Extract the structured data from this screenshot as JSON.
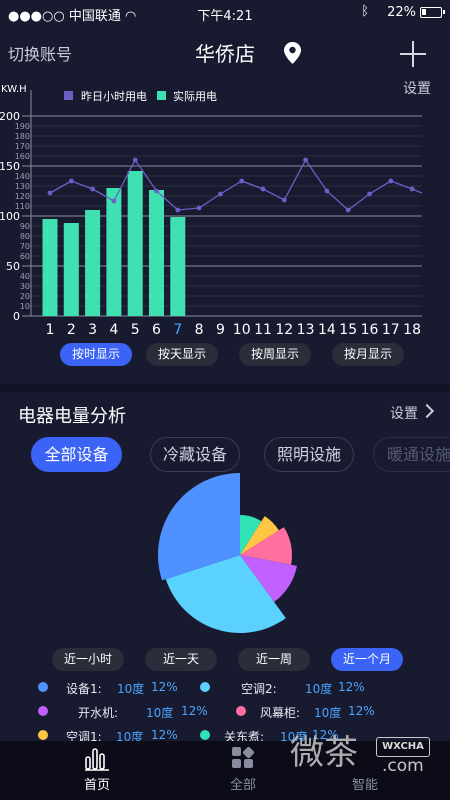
{
  "status": {
    "signal": "●●●○○ 中国联通 ",
    "time": "下午4:21",
    "battery": "22%"
  },
  "header": {
    "switch_account": "切换账号",
    "title": "华侨店",
    "settings": "设置"
  },
  "chart_data": {
    "type": "bar",
    "unit_label": "KW.H",
    "legend": [
      "昨日小时用电",
      "实际用电"
    ],
    "x": [
      "1",
      "2",
      "3",
      "4",
      "5",
      "6",
      "7",
      "8",
      "9",
      "10",
      "11",
      "12",
      "13",
      "14",
      "15",
      "16",
      "17",
      "18"
    ],
    "highlight_x": "7",
    "ylim": [
      0,
      200
    ],
    "y_ticks": [
      0,
      10,
      20,
      30,
      40,
      50,
      60,
      70,
      80,
      90,
      100,
      110,
      120,
      130,
      140,
      150,
      160,
      170,
      180,
      190,
      200
    ],
    "y_major": [
      0,
      50,
      100,
      150,
      200
    ],
    "series": [
      {
        "name": "实际用电",
        "kind": "bar",
        "color": "#3fe1b0",
        "values": [
          97,
          93,
          106,
          128,
          145,
          126,
          99
        ]
      },
      {
        "name": "昨日小时用电",
        "kind": "line",
        "color": "#6b5fc7",
        "values": [
          123,
          135,
          127,
          115,
          156,
          125,
          106,
          108,
          122,
          135,
          127,
          116,
          156,
          125,
          106,
          122,
          135,
          127
        ]
      }
    ]
  },
  "chart_toggles": [
    "按时显示",
    "按天显示",
    "按周显示",
    "按月显示"
  ],
  "analysis": {
    "title": "电器电量分析",
    "settings": "设置"
  },
  "categories": [
    "全部设备",
    "冷藏设备",
    "照明设施",
    "暖通设施"
  ],
  "pie_data": {
    "type": "pie",
    "slices": [
      {
        "name": "设备1",
        "color": "#4f92ff",
        "fraction": 0.3
      },
      {
        "name": "空调2",
        "color": "#5bd1ff",
        "fraction": 0.3
      },
      {
        "name": "开水机",
        "color": "#c061ff",
        "fraction": 0.12
      },
      {
        "name": "风幕柜",
        "color": "#ff6fa0",
        "fraction": 0.12
      },
      {
        "name": "空调1",
        "color": "#ffc646",
        "fraction": 0.07
      },
      {
        "name": "关东煮",
        "color": "#2fe3b4",
        "fraction": 0.09
      }
    ]
  },
  "periods": [
    "近一小时",
    "近一天",
    "近一周",
    "近一个月"
  ],
  "legend_rows": [
    {
      "name": "设备1:",
      "value": "10度",
      "pct": "12%",
      "color": "#4f92ff"
    },
    {
      "name": "空调2:",
      "value": "10度",
      "pct": "12%",
      "color": "#5bd1ff"
    },
    {
      "name": "开水机:",
      "value": "10度",
      "pct": "12%",
      "color": "#c061ff"
    },
    {
      "name": "风幕柜:",
      "value": "10度",
      "pct": "12%",
      "color": "#ff6fa0"
    },
    {
      "name": "空调1:",
      "value": "10度",
      "pct": "12%",
      "color": "#ffc646"
    },
    {
      "name": "关东煮:",
      "value": "10度",
      "pct": "12%",
      "color": "#2fe3b4"
    }
  ],
  "tabs": [
    "首页",
    "全部",
    "智能"
  ],
  "watermark": {
    "text": "微茶",
    "box": "WXCHA",
    "domain": ".com"
  }
}
